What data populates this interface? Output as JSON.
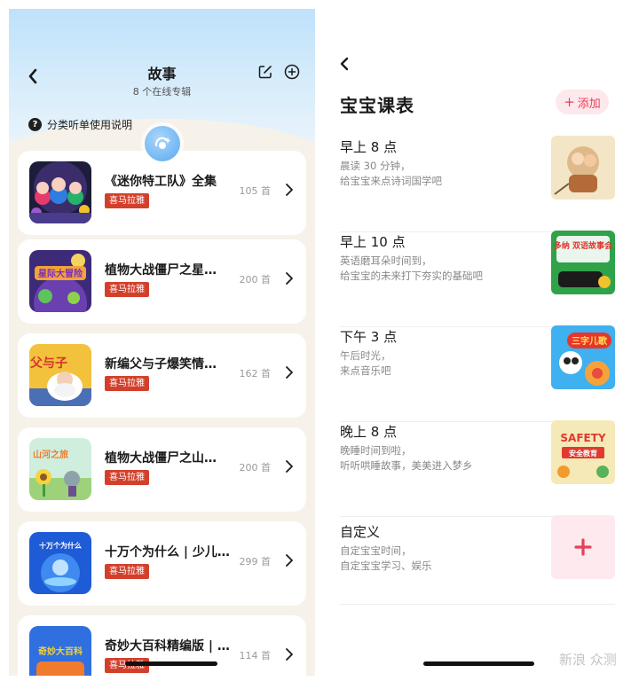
{
  "left": {
    "title": "故事",
    "subtitle": "8 个在线专辑",
    "help_text": "分类听单使用说明",
    "help_glyph": "?",
    "albums": [
      {
        "title": "《迷你特工队》全集",
        "badge": "喜马拉雅",
        "count": "105 首"
      },
      {
        "title": "植物大战僵尸之星…",
        "badge": "喜马拉雅",
        "count": "200 首"
      },
      {
        "title": "新编父与子爆笑情…",
        "badge": "喜马拉雅",
        "count": "162 首"
      },
      {
        "title": "植物大战僵尸之山…",
        "badge": "喜马拉雅",
        "count": "200 首"
      },
      {
        "title": "十万个为什么 | 少儿…",
        "badge": "喜马拉雅",
        "count": "299 首"
      },
      {
        "title": "奇妙大百科精编版 | …",
        "badge": "喜马拉雅",
        "count": "114 首"
      }
    ],
    "cover_text": {
      "1": "星际大冒险",
      "2": "父与子",
      "3": "山河之旅",
      "4": "十万个为什么",
      "5": "奇妙大百科"
    }
  },
  "right": {
    "title": "宝宝课表",
    "add_label": "添加",
    "add_glyph": "+",
    "schedule": [
      {
        "time": "早上 8 点",
        "desc1": "晨读 30 分钟，",
        "desc2": "给宝宝来点诗词国学吧"
      },
      {
        "time": "早上 10 点",
        "desc1": "英语磨耳朵时间到，",
        "desc2": "给宝宝的未来打下夯实的基础吧"
      },
      {
        "time": "下午 3 点",
        "desc1": "午后时光，",
        "desc2": "来点音乐吧"
      },
      {
        "time": "晚上 8 点",
        "desc1": "晚睡时间到啦，",
        "desc2": "听听哄睡故事，美美进入梦乡"
      },
      {
        "time": "自定义",
        "desc1": "自定宝宝时间，",
        "desc2": "自定宝宝学习、娱乐"
      }
    ],
    "thumb_text": {
      "1": "多纳 双语故事会",
      "2": "三字儿歌",
      "3_a": "SAFETY",
      "3_b": "安全教育"
    },
    "watermark": "新浪 众测"
  },
  "colors": {
    "accent_red": "#e8405a",
    "badge_red": "#d2402c",
    "header_blue": "#bfe1fb",
    "panel_bg": "#f6f2ea"
  }
}
